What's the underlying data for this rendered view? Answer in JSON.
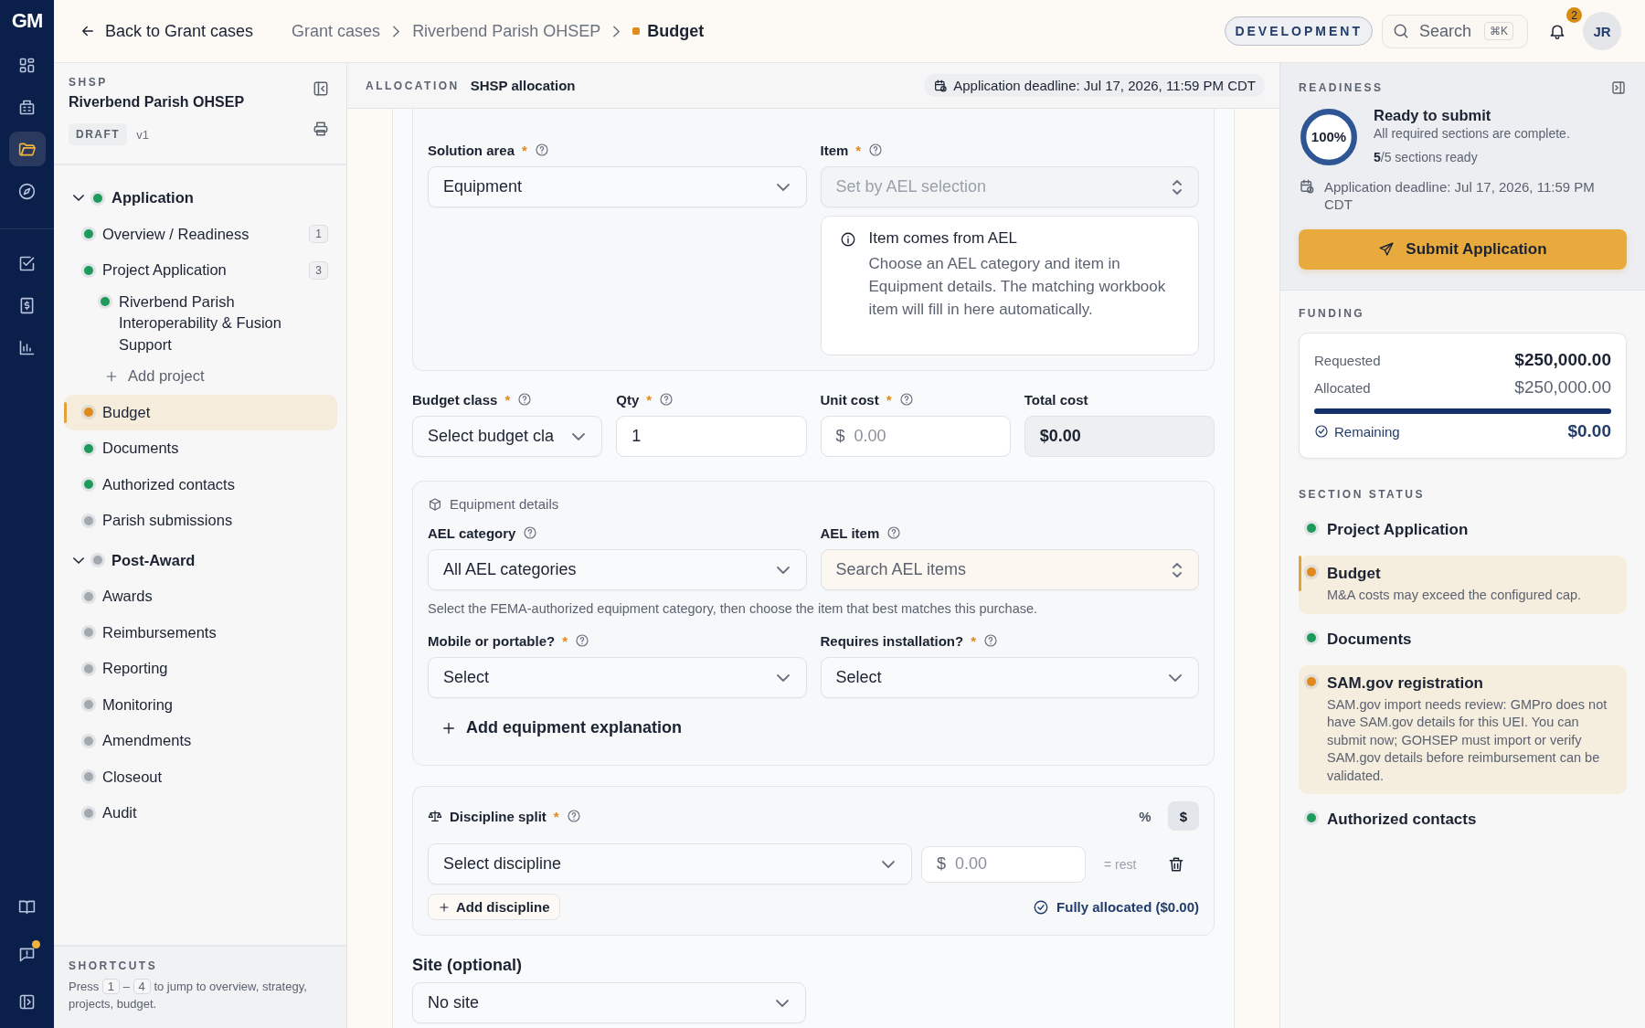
{
  "rail": {
    "logo": "GM",
    "items": [
      {
        "kind": "grid",
        "selected": false
      },
      {
        "kind": "building",
        "selected": false
      },
      {
        "kind": "folder",
        "selected": true
      },
      {
        "kind": "compass",
        "selected": false
      },
      {
        "kind": "checkbox",
        "selected": false
      },
      {
        "kind": "receipt",
        "selected": false
      },
      {
        "kind": "chart",
        "selected": false
      }
    ],
    "bottom": [
      {
        "kind": "book",
        "badge": false
      },
      {
        "kind": "chat",
        "badge": true
      },
      {
        "kind": "panel",
        "badge": false
      }
    ]
  },
  "topbar": {
    "back": "Back to Grant cases",
    "breadcrumbs": [
      {
        "label": "Grant cases",
        "current": false
      },
      {
        "label": "Riverbend Parish OHSEP",
        "current": false
      },
      {
        "label": "Budget",
        "current": true
      }
    ],
    "environment": "DEVELOPMENT",
    "search": {
      "placeholder": "Search",
      "shortcut": "⌘K"
    },
    "notifications": "2",
    "avatar": "JR"
  },
  "sidebar": {
    "program": "SHSP",
    "title": "Riverbend Parish OHSEP",
    "status": "DRAFT",
    "version": "v1",
    "tree": [
      {
        "kind": "group",
        "label": "Application",
        "color": "#1e9a5a",
        "expanded": true,
        "children": [
          {
            "kind": "page",
            "label": "Overview / Readiness",
            "color": "#1e9a5a",
            "count": "1",
            "selected": false
          },
          {
            "kind": "page",
            "label": "Project Application",
            "color": "#1e9a5a",
            "count": "3",
            "selected": false,
            "children": [
              {
                "kind": "project",
                "label": "Riverbend Parish Interoperability & Fusion Support",
                "color": "#1e9a5a",
                "selected": false
              },
              {
                "kind": "action",
                "label": "Add project"
              }
            ]
          },
          {
            "kind": "page",
            "label": "Budget",
            "color": "#e08a1e",
            "selected": true
          },
          {
            "kind": "page",
            "label": "Documents",
            "color": "#1e9a5a",
            "selected": false
          },
          {
            "kind": "page",
            "label": "Authorized contacts",
            "color": "#1e9a5a",
            "selected": false
          },
          {
            "kind": "page",
            "label": "Parish submissions",
            "color": "#a3a8b1",
            "selected": false
          }
        ]
      },
      {
        "kind": "group",
        "label": "Post-Award",
        "color": "#a3a8b1",
        "expanded": true,
        "children": [
          {
            "kind": "page",
            "label": "Awards",
            "color": "#a3a8b1",
            "selected": false
          },
          {
            "kind": "page",
            "label": "Reimbursements",
            "color": "#a3a8b1",
            "selected": false
          },
          {
            "kind": "page",
            "label": "Reporting",
            "color": "#a3a8b1",
            "selected": false
          },
          {
            "kind": "page",
            "label": "Monitoring",
            "color": "#a3a8b1",
            "selected": false
          },
          {
            "kind": "page",
            "label": "Amendments",
            "color": "#a3a8b1",
            "selected": false
          },
          {
            "kind": "page",
            "label": "Closeout",
            "color": "#a3a8b1",
            "selected": false
          },
          {
            "kind": "page",
            "label": "Audit",
            "color": "#a3a8b1",
            "selected": false
          }
        ]
      }
    ],
    "shortcuts": {
      "title": "SHORTCUTS",
      "before": "Press",
      "keys": [
        "1",
        "4"
      ],
      "separator": "–",
      "after": "to jump to overview, strategy, projects, budget."
    }
  },
  "allocation": {
    "label": "ALLOCATION",
    "value": "SHSP allocation",
    "deadline": "Application deadline: Jul 17, 2026, 11:59 PM CDT"
  },
  "form": {
    "solution_area": {
      "label": "Solution area",
      "required_mark": "*",
      "value": "Equipment"
    },
    "item": {
      "label": "Item",
      "required_mark": "*",
      "placeholder": "Set by AEL selection",
      "disabled": true
    },
    "info": {
      "title": "Item comes from AEL",
      "text": "Choose an AEL category and item in Equipment details. The matching workbook item will fill in here automatically."
    },
    "budget_class": {
      "label": "Budget class",
      "required_mark": "*",
      "placeholder": "Select budget cla"
    },
    "qty": {
      "label": "Qty",
      "required_mark": "*",
      "value": "1"
    },
    "unit_cost": {
      "label": "Unit cost",
      "required_mark": "*",
      "prefix": "$",
      "placeholder": "0.00"
    },
    "total_cost": {
      "label": "Total cost",
      "value": "$0.00"
    },
    "equipment": {
      "title": "Equipment details",
      "ael_category": {
        "label": "AEL category",
        "value": "All AEL categories"
      },
      "ael_item": {
        "label": "AEL item",
        "placeholder": "Search AEL items"
      },
      "hint": "Select the FEMA-authorized equipment category, then choose the item that best matches this purchase.",
      "mobile": {
        "label": "Mobile or portable?",
        "required_mark": "*",
        "value": "Select"
      },
      "installation": {
        "label": "Requires installation?",
        "required_mark": "*",
        "value": "Select"
      },
      "add_explanation": "Add equipment explanation"
    },
    "discipline": {
      "title": "Discipline split",
      "required_mark": "*",
      "units": [
        {
          "label": "%",
          "selected": false
        },
        {
          "label": "$",
          "selected": true
        }
      ],
      "select": "Select discipline",
      "prefix": "$",
      "placeholder": "0.00",
      "rest": "= rest",
      "add": "Add discipline",
      "status": "Fully allocated ($0.00)"
    },
    "site": {
      "label": "Site (optional)",
      "value": "No site"
    }
  },
  "readiness": {
    "title": "READINESS",
    "percent": "100%",
    "level": 1.0,
    "heading": "Ready to submit",
    "subtitle": "All required sections are complete.",
    "count": "**5**/5 sections ready",
    "deadline": "Application deadline: Jul 17, 2026, 11:59 PM CDT",
    "submit": "Submit Application"
  },
  "funding": {
    "title": "FUNDING",
    "requested_label": "Requested",
    "requested": "$250,000.00",
    "allocated_label": "Allocated",
    "allocated": "$250,000.00",
    "level": 1.0,
    "remaining_label": "Remaining",
    "remaining": "$0.00"
  },
  "section_status": {
    "title": "SECTION STATUS",
    "items": [
      {
        "label": "Project Application",
        "color": "#1e9a5a",
        "warning": false,
        "selected": false
      },
      {
        "label": "Budget",
        "note": "M&A costs may exceed the configured cap.",
        "color": "#e08a1e",
        "warning": true,
        "selected": true
      },
      {
        "label": "Documents",
        "color": "#1e9a5a",
        "warning": false,
        "selected": false
      },
      {
        "label": "SAM.gov registration",
        "note": "SAM.gov import needs review: GMPro does not have SAM.gov details for this UEI. You can submit now; GOHSEP must import or verify SAM.gov details before reimbursement can be validated.",
        "color": "#e08a1e",
        "warning": true,
        "selected": false
      },
      {
        "label": "Authorized contacts",
        "color": "#1e9a5a",
        "warning": false,
        "selected": false
      }
    ]
  }
}
